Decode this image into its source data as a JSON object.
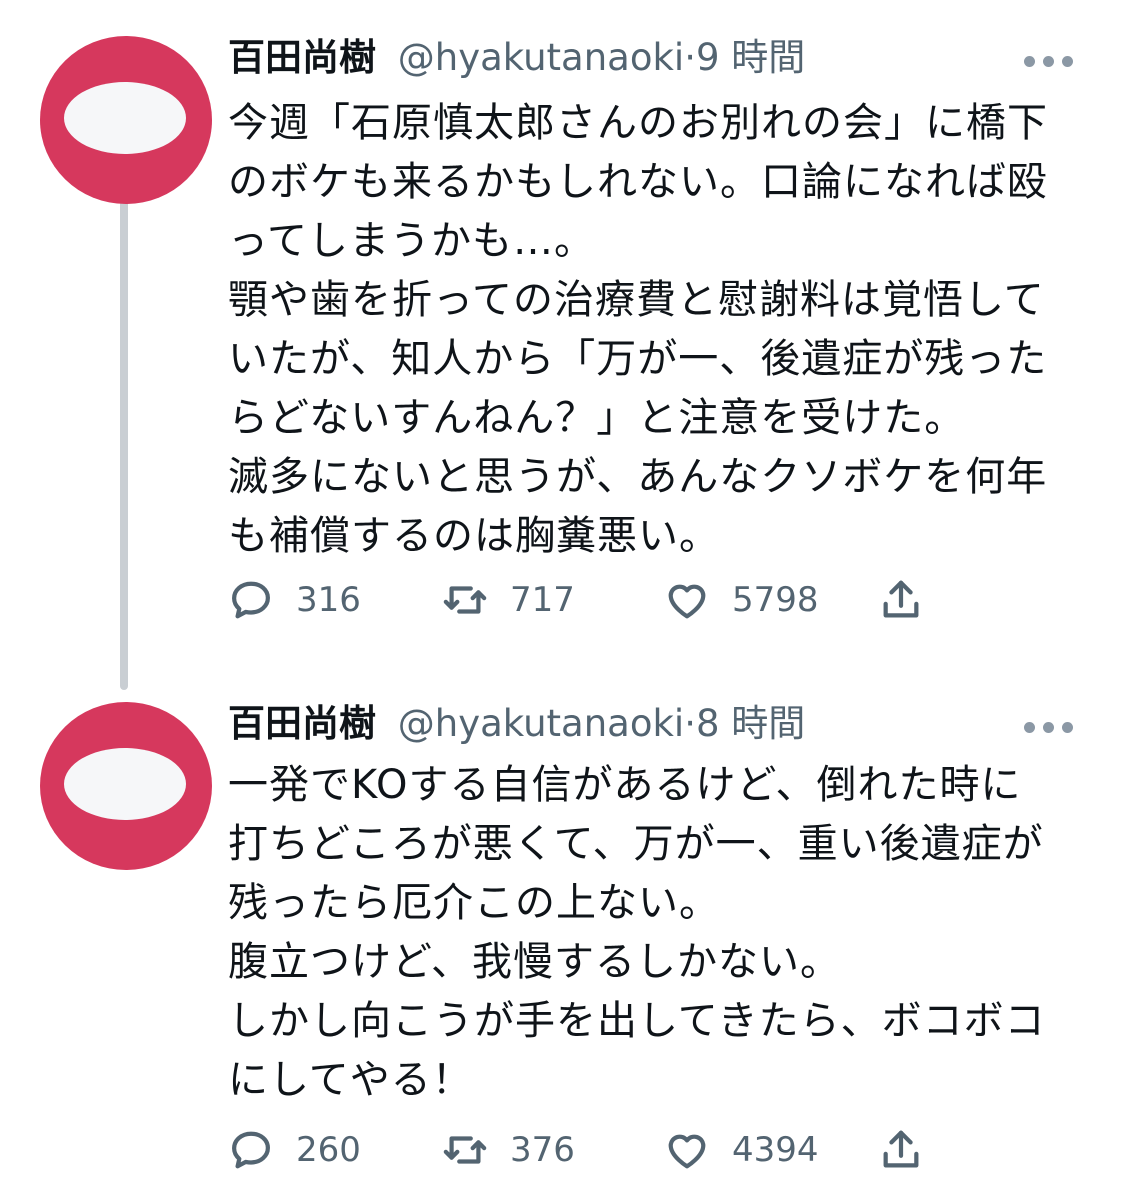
{
  "tweets": [
    {
      "name": "百田尚樹",
      "handle": "@hyakutanaoki",
      "dot": "·",
      "time": "9 時間",
      "lines": [
        "今週「石原慎太郎さんのお別れの会」に橋下",
        "のボケも来るかもしれない。口論になれば殴",
        "ってしまうかも…。",
        "顎や歯を折っての治療費と慰謝料は覚悟して",
        "いたが、知人から「万が一、後遺症が残った",
        "らどないすんねん？」と注意を受けた。",
        "滅多にないと思うが、あんなクソボケを何年",
        "も補償するのは胸糞悪い。"
      ],
      "replies": "316",
      "retweets": "717",
      "likes": "5798"
    },
    {
      "name": "百田尚樹",
      "handle": "@hyakutanaoki",
      "dot": "·",
      "time": "8 時間",
      "lines": [
        "一発でKOする自信があるけど、倒れた時に",
        "打ちどころが悪くて、万が一、重い後遺症が",
        "残ったら厄介この上ない。",
        "腹立つけど、我慢するしかない。",
        "しかし向こうが手を出してきたら、ボコボコ",
        "にしてやる！"
      ],
      "replies": "260",
      "retweets": "376",
      "likes": "4394"
    }
  ],
  "icons": {
    "reply": "reply-icon",
    "retweet": "retweet-icon",
    "like": "heart-icon",
    "share": "share-icon",
    "more": "more-icon"
  },
  "colors": {
    "avatar": "#d6385d",
    "secondary_text": "#536471",
    "thread_line": "#c9ced3"
  }
}
